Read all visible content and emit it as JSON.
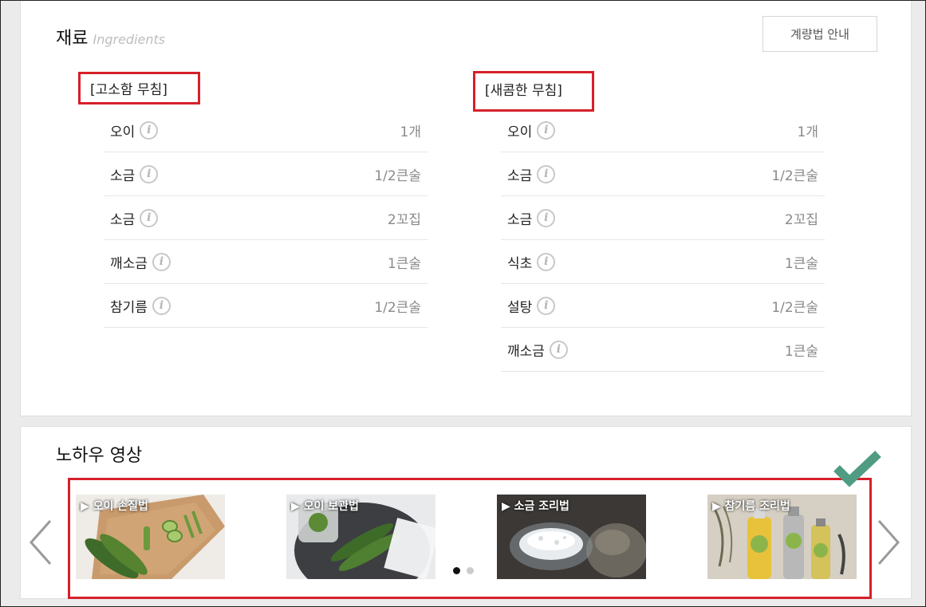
{
  "ingredients": {
    "title": "재료",
    "subtitle": "Ingredients",
    "guide_button": "계량법 안내",
    "groups": [
      {
        "label": "[고소함 무침]",
        "items": [
          {
            "name": "오이",
            "amount": "1개"
          },
          {
            "name": "소금",
            "amount": "1/2큰술"
          },
          {
            "name": "소금",
            "amount": "2꼬집"
          },
          {
            "name": "깨소금",
            "amount": "1큰술"
          },
          {
            "name": "참기름",
            "amount": "1/2큰술"
          }
        ]
      },
      {
        "label": "[새콤한 무침]",
        "items": [
          {
            "name": "오이",
            "amount": "1개"
          },
          {
            "name": "소금",
            "amount": "1/2큰술"
          },
          {
            "name": "소금",
            "amount": "2꼬집"
          },
          {
            "name": "식초",
            "amount": "1큰술"
          },
          {
            "name": "설탕",
            "amount": "1/2큰술"
          },
          {
            "name": "깨소금",
            "amount": "1큰술"
          }
        ]
      }
    ],
    "info_icon_glyph": "i"
  },
  "videos": {
    "title": "노하우 영상",
    "items": [
      {
        "caption": "▶ 오이 손질법",
        "icon": "cucumber-cutting-board-thumbnail"
      },
      {
        "caption": "▶ 오이 보관법",
        "icon": "cucumber-storage-thumbnail"
      },
      {
        "caption": "▶ 소금 조리법",
        "icon": "salt-bowl-thumbnail"
      },
      {
        "caption": "▶ 참기름 조리법",
        "icon": "sesame-oil-bottles-thumbnail"
      }
    ],
    "page_count": 2,
    "active_page": 1
  },
  "colors": {
    "highlight": "#d6202a",
    "check": "#4f9c83"
  }
}
